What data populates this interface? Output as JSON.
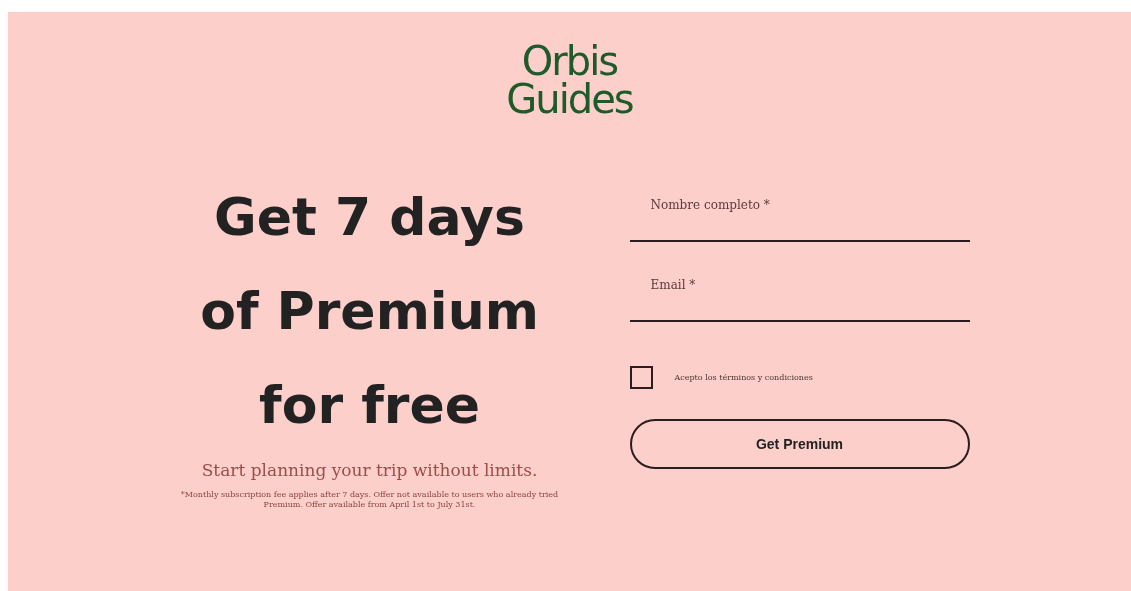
{
  "logo": {
    "line_1": "Orbis",
    "line_2": "Guides"
  },
  "headline": [
    "Get 7 days",
    "of Premium",
    "for free"
  ],
  "subtitle": "Start planning your trip without limits.",
  "fine_print": "*Monthly subscription fee applies after 7 days. Offer not available to users who already tried Premium. Offer available from April 1st to July 31st.",
  "form": {
    "fields": [
      {
        "placeholder": "Nombre completo *"
      },
      {
        "placeholder": "Email *"
      }
    ],
    "terms": {
      "label": "Acepto los términos y condiciones",
      "checked": false
    },
    "submit": "Get Premium"
  }
}
